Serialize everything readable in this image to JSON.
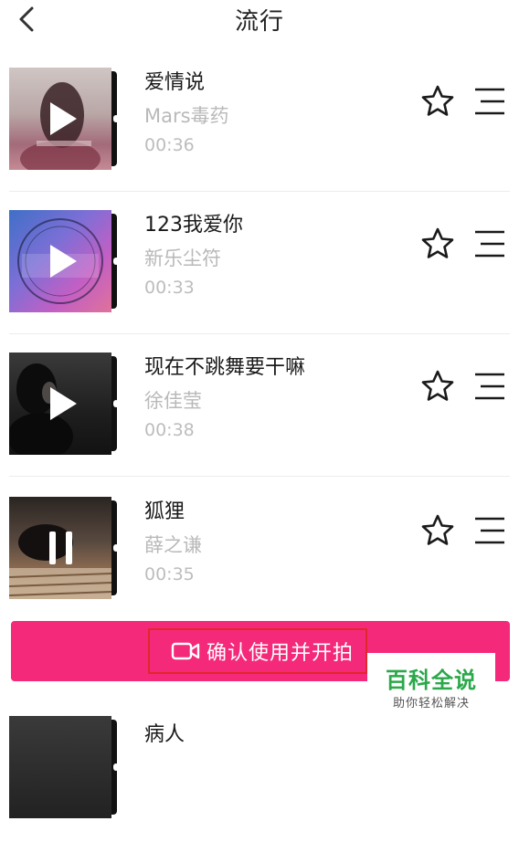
{
  "header": {
    "title": "流行",
    "back_icon": "chevron-left-icon"
  },
  "songs": [
    {
      "title": "爱情说",
      "artist": "Mars毒药",
      "duration": "00:36",
      "state": "play"
    },
    {
      "title": "123我爱你",
      "artist": "新乐尘符",
      "duration": "00:33",
      "state": "play"
    },
    {
      "title": "现在不跳舞要干嘛",
      "artist": "徐佳莹",
      "duration": "00:38",
      "state": "play"
    },
    {
      "title": "狐狸",
      "artist": "薛之谦",
      "duration": "00:35",
      "state": "pause"
    },
    {
      "title": "病人"
    }
  ],
  "confirm": {
    "label": "确认使用并开拍",
    "icon": "video-camera-icon",
    "color": "#f5297a"
  },
  "watermark": {
    "main": "百科全说",
    "sub": "助你轻松解决"
  }
}
